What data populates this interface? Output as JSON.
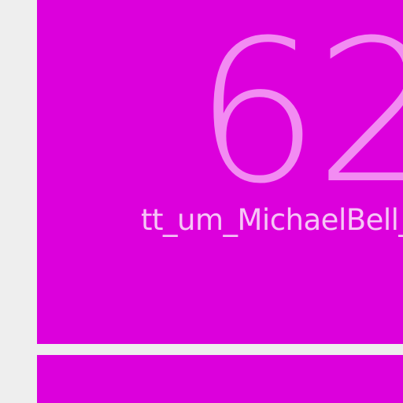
{
  "tiles": [
    {
      "count": "62",
      "label": "tt_um_MichaelBell_"
    }
  ],
  "colors": {
    "background": "#eeeeee",
    "tile_background": "#dc00dc",
    "count_text": "#f28cf2",
    "label_text": "#f6c6f6"
  }
}
